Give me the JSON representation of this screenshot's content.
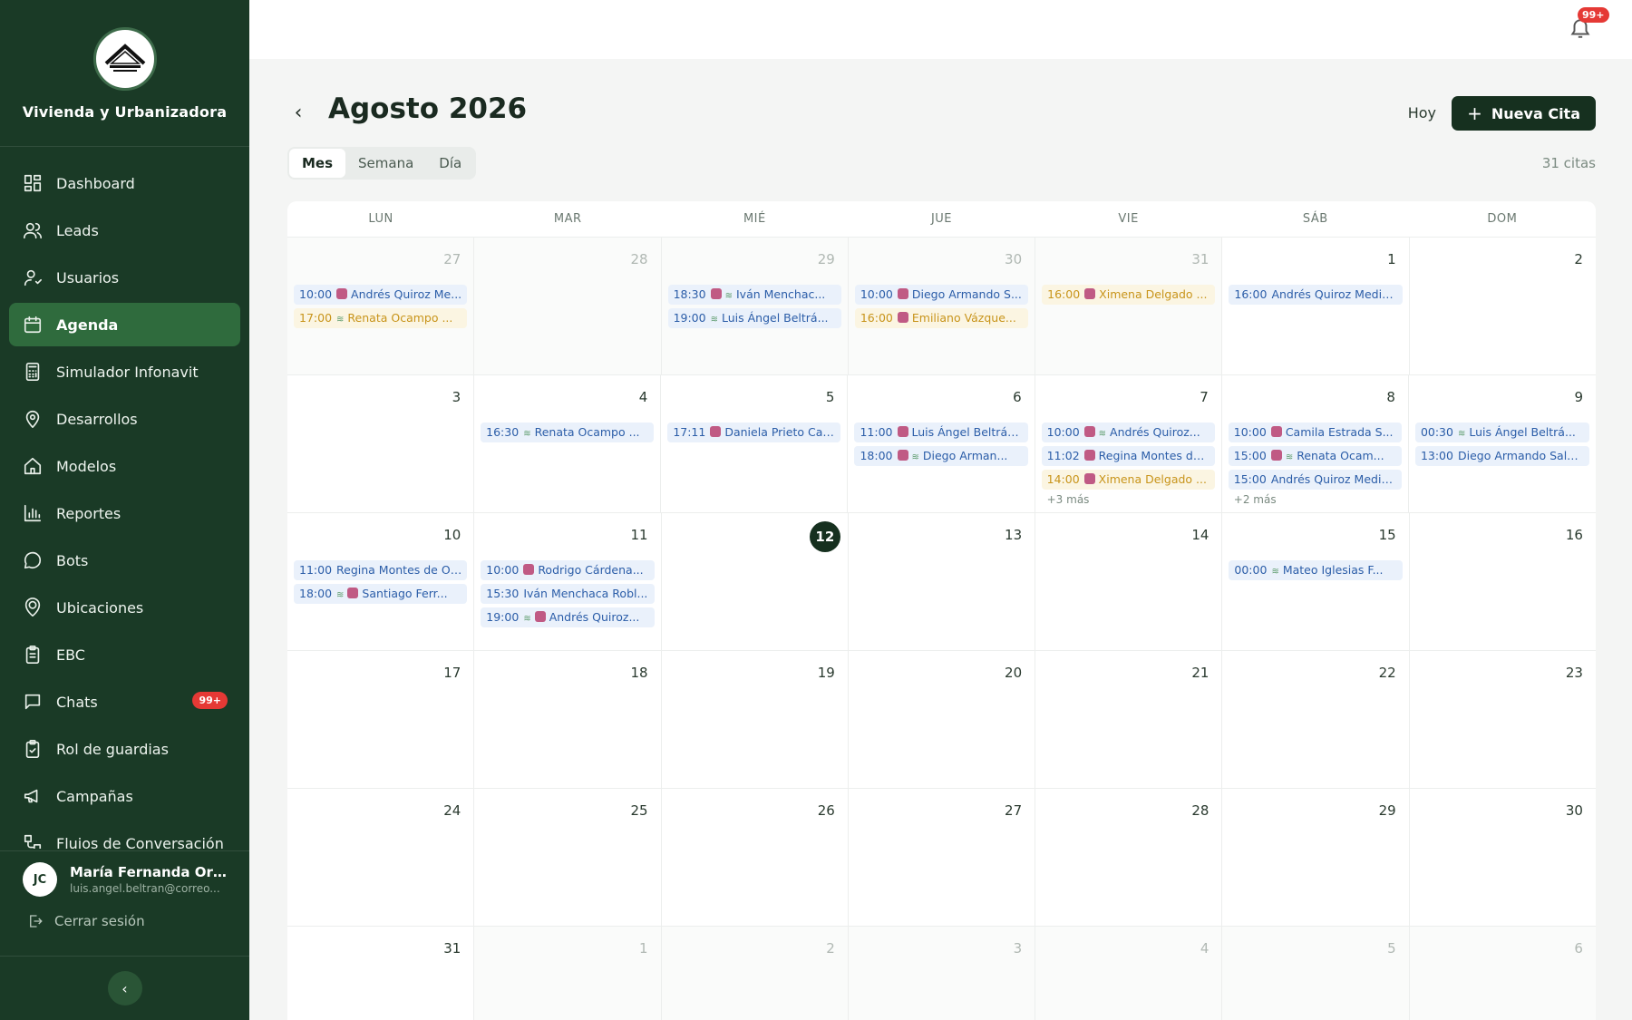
{
  "brand": {
    "name": "Vivienda y Urbanizadora"
  },
  "colors": {
    "sidebar": "#1a3a26",
    "active": "#2f6b3d",
    "primary": "#16301f",
    "badge": "#e53935",
    "event_blue": "#2b5da8",
    "event_yellow": "#c8941a"
  },
  "nav": [
    {
      "label": "Dashboard",
      "icon": "dashboard-icon"
    },
    {
      "label": "Leads",
      "icon": "users-icon"
    },
    {
      "label": "Usuarios",
      "icon": "user-icon"
    },
    {
      "label": "Agenda",
      "icon": "calendar-icon",
      "active": true
    },
    {
      "label": "Simulador Infonavit",
      "icon": "calculator-icon"
    },
    {
      "label": "Desarrollos",
      "icon": "map-pin-icon"
    },
    {
      "label": "Modelos",
      "icon": "home-icon"
    },
    {
      "label": "Reportes",
      "icon": "bar-chart-icon"
    },
    {
      "label": "Bots",
      "icon": "message-circle-icon"
    },
    {
      "label": "Ubicaciones",
      "icon": "location-user-icon"
    },
    {
      "label": "EBC",
      "icon": "clipboard-icon"
    },
    {
      "label": "Chats",
      "icon": "chat-icon",
      "badge": "99+"
    },
    {
      "label": "Rol de guardias",
      "icon": "clipboard-check-icon"
    },
    {
      "label": "Campañas",
      "icon": "megaphone-icon"
    },
    {
      "label": "Flujos de Conversación",
      "icon": "workflow-icon"
    }
  ],
  "user": {
    "initials": "JC",
    "name": "María Fernanda Orte...",
    "email": "luis.angel.beltran@correo..."
  },
  "logout_label": "Cerrar sesión",
  "topbar": {
    "notif_badge": "99+"
  },
  "header": {
    "month_title": "Agosto 2026",
    "today_label": "Hoy",
    "new_label": "Nueva Cita",
    "count_text": "31 citas"
  },
  "views": [
    "Mes",
    "Semana",
    "Día"
  ],
  "active_view": "Mes",
  "weekdays": [
    "LUN",
    "MAR",
    "MIÉ",
    "JUE",
    "VIE",
    "SÁB",
    "DOM"
  ],
  "weeks": [
    [
      {
        "d": "27",
        "other": true,
        "events": [
          {
            "time": "10:00",
            "name": "Andrés Quiroz Me...",
            "color": "blue",
            "icons": [
              "lead"
            ]
          },
          {
            "time": "17:00",
            "name": "Renata Ocampo ...",
            "color": "yellow",
            "icons": [
              "bot"
            ]
          }
        ]
      },
      {
        "d": "28",
        "other": true,
        "events": []
      },
      {
        "d": "29",
        "other": true,
        "events": [
          {
            "time": "18:30",
            "name": "Iván Menchac...",
            "color": "blue",
            "icons": [
              "lead",
              "bot"
            ]
          },
          {
            "time": "19:00",
            "name": "Luis Ángel Beltrá...",
            "color": "blue",
            "icons": [
              "bot"
            ]
          }
        ]
      },
      {
        "d": "30",
        "other": true,
        "events": [
          {
            "time": "10:00",
            "name": "Diego Armando S...",
            "color": "blue",
            "icons": [
              "lead"
            ]
          },
          {
            "time": "16:00",
            "name": "Emiliano Vázque...",
            "color": "yellow",
            "icons": [
              "lead"
            ]
          }
        ]
      },
      {
        "d": "31",
        "other": true,
        "events": [
          {
            "time": "16:00",
            "name": "Ximena Delgado ...",
            "color": "yellow",
            "icons": [
              "lead"
            ]
          }
        ]
      },
      {
        "d": "1",
        "events": [
          {
            "time": "16:00",
            "name": "Andrés Quiroz Medin...",
            "color": "blue",
            "icons": []
          }
        ]
      },
      {
        "d": "2",
        "events": []
      }
    ],
    [
      {
        "d": "3",
        "events": []
      },
      {
        "d": "4",
        "events": [
          {
            "time": "16:30",
            "name": "Renata Ocampo ...",
            "color": "blue",
            "icons": [
              "bot"
            ]
          }
        ]
      },
      {
        "d": "5",
        "events": [
          {
            "time": "17:11",
            "name": "Daniela Prieto Can...",
            "color": "blue",
            "icons": [
              "lead"
            ]
          }
        ]
      },
      {
        "d": "6",
        "events": [
          {
            "time": "11:00",
            "name": "Luis Ángel Beltrán...",
            "color": "blue",
            "icons": [
              "lead"
            ]
          },
          {
            "time": "18:00",
            "name": "Diego Arman...",
            "color": "blue",
            "icons": [
              "lead",
              "bot"
            ]
          }
        ]
      },
      {
        "d": "7",
        "events": [
          {
            "time": "10:00",
            "name": "Andrés Quiroz...",
            "color": "blue",
            "icons": [
              "lead",
              "bot"
            ]
          },
          {
            "time": "11:02",
            "name": "Regina Montes de...",
            "color": "blue",
            "icons": [
              "lead"
            ]
          },
          {
            "time": "14:00",
            "name": "Ximena Delgado ...",
            "color": "yellow",
            "icons": [
              "lead"
            ]
          }
        ],
        "more": "+3 más"
      },
      {
        "d": "8",
        "events": [
          {
            "time": "10:00",
            "name": "Camila Estrada S...",
            "color": "blue",
            "icons": [
              "lead"
            ]
          },
          {
            "time": "15:00",
            "name": "Renata Ocam...",
            "color": "blue",
            "icons": [
              "lead",
              "bot"
            ]
          },
          {
            "time": "15:00",
            "name": "Andrés Quiroz Medin...",
            "color": "blue",
            "icons": []
          }
        ],
        "more": "+2 más"
      },
      {
        "d": "9",
        "events": [
          {
            "time": "00:30",
            "name": "Luis Ángel Beltrá...",
            "color": "blue",
            "icons": [
              "bot"
            ]
          },
          {
            "time": "13:00",
            "name": "Diego Armando Salg...",
            "color": "blue",
            "icons": []
          }
        ]
      }
    ],
    [
      {
        "d": "10",
        "events": [
          {
            "time": "11:00",
            "name": "Regina Montes de Oc...",
            "color": "blue",
            "icons": []
          },
          {
            "time": "18:00",
            "name": "Santiago Ferr...",
            "color": "blue",
            "icons": [
              "bot",
              "lead"
            ]
          }
        ]
      },
      {
        "d": "11",
        "events": [
          {
            "time": "10:00",
            "name": "Rodrigo Cárdena...",
            "color": "blue",
            "icons": [
              "lead"
            ]
          },
          {
            "time": "15:30",
            "name": "Iván Menchaca Robl...",
            "color": "blue",
            "icons": []
          },
          {
            "time": "19:00",
            "name": "Andrés Quiroz...",
            "color": "blue",
            "icons": [
              "bot",
              "lead"
            ]
          }
        ]
      },
      {
        "d": "12",
        "today": true,
        "events": []
      },
      {
        "d": "13",
        "events": []
      },
      {
        "d": "14",
        "events": []
      },
      {
        "d": "15",
        "events": [
          {
            "time": "00:00",
            "name": "Mateo Iglesias F...",
            "color": "blue",
            "icons": [
              "bot"
            ]
          }
        ]
      },
      {
        "d": "16",
        "events": []
      }
    ],
    [
      {
        "d": "17",
        "events": []
      },
      {
        "d": "18",
        "events": []
      },
      {
        "d": "19",
        "events": []
      },
      {
        "d": "20",
        "events": []
      },
      {
        "d": "21",
        "events": []
      },
      {
        "d": "22",
        "events": []
      },
      {
        "d": "23",
        "events": []
      }
    ],
    [
      {
        "d": "24",
        "events": []
      },
      {
        "d": "25",
        "events": []
      },
      {
        "d": "26",
        "events": []
      },
      {
        "d": "27",
        "events": []
      },
      {
        "d": "28",
        "events": []
      },
      {
        "d": "29",
        "events": []
      },
      {
        "d": "30",
        "events": []
      }
    ],
    [
      {
        "d": "31",
        "events": []
      },
      {
        "d": "1",
        "other": true,
        "events": []
      },
      {
        "d": "2",
        "other": true,
        "events": []
      },
      {
        "d": "3",
        "other": true,
        "events": []
      },
      {
        "d": "4",
        "other": true,
        "events": []
      },
      {
        "d": "5",
        "other": true,
        "events": []
      },
      {
        "d": "6",
        "other": true,
        "events": []
      }
    ]
  ]
}
